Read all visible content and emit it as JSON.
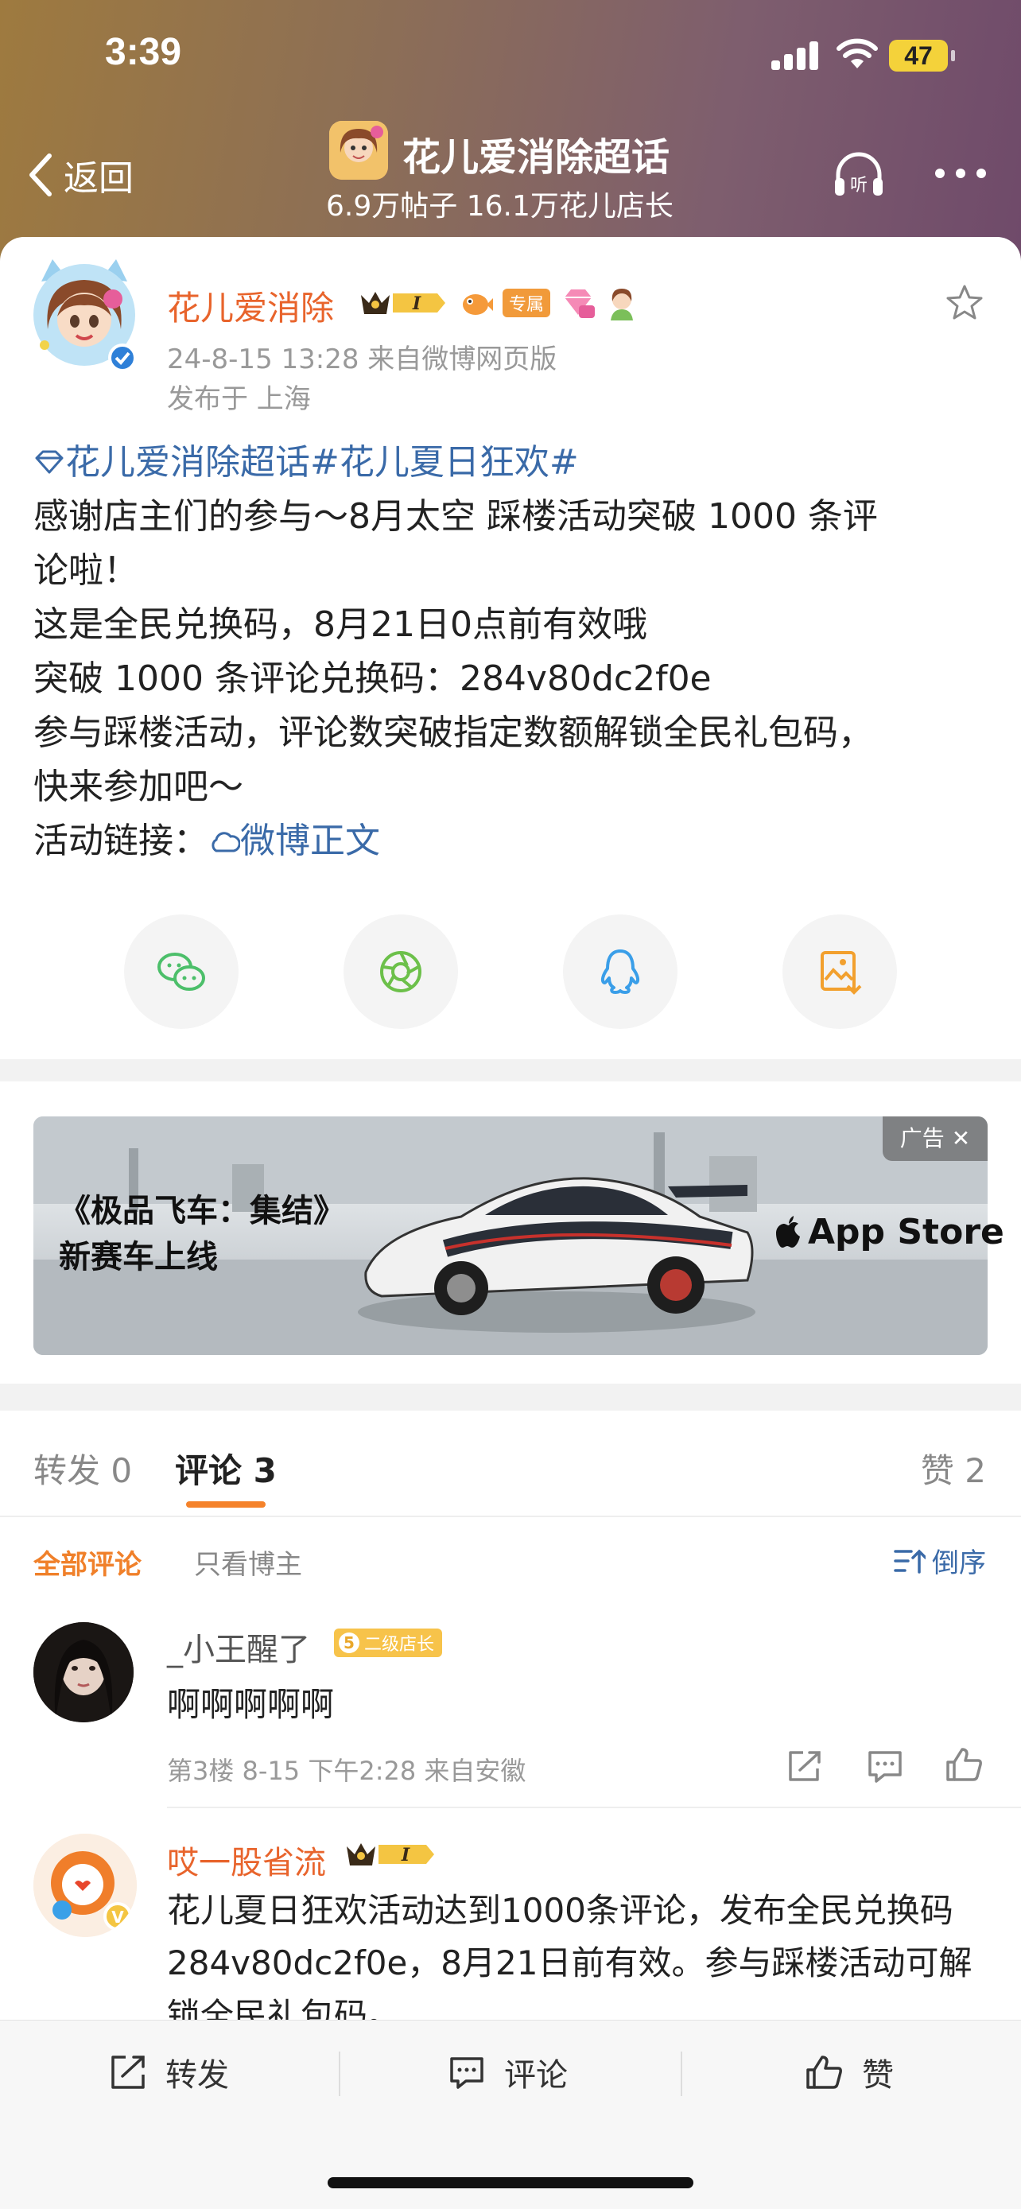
{
  "status": {
    "time": "3:39",
    "battery": "47"
  },
  "nav": {
    "back_label": "返回",
    "title": "花儿爱消除超话",
    "subtitle": "6.9万帖子 16.1万花儿店长"
  },
  "post": {
    "author": "花儿爱消除",
    "badge_zs": "专属",
    "meta_time_source": "24-8-15 13:28  来自微博网页版",
    "meta_location": "发布于 上海",
    "topic_prefix": "花儿爱消除超话#花儿夏日狂欢#",
    "lines": [
      "感谢店主们的参与～8月太空 踩楼活动突破 1000 条评",
      "论啦！",
      "这是全民兑换码，8月21日0点前有效哦",
      "突破 1000 条评论兑换码：284v80dc2f0e",
      "参与踩楼活动，评论数突破指定数额解锁全民礼包码，",
      "快来参加吧～"
    ],
    "link_label": "活动链接：",
    "link_text": "微博正文"
  },
  "ad": {
    "line1": "《极品飞车：集结》",
    "line2": "新赛车上线",
    "store": "App Store",
    "tag": "广告"
  },
  "tabs": {
    "repost": "转发 0",
    "comment": "评论 3",
    "like": "赞 2"
  },
  "filters": {
    "all": "全部评论",
    "author_only": "只看博主",
    "sort": "倒序"
  },
  "comments": [
    {
      "name": "_小王醒了",
      "badge_level": "5",
      "badge_text": "二级店长",
      "text": "啊啊啊啊啊",
      "meta": "第3楼 8-15 下午2:28  来自安徽"
    },
    {
      "name": "哎一股省流",
      "text": "花儿夏日狂欢活动达到1000条评论，发布全民兑换码284v80dc2f0e，8月21日前有效。参与踩楼活动可解锁全民礼包码。"
    }
  ],
  "toolbar": {
    "repost": "转发",
    "comment": "评论",
    "like": "赞"
  },
  "colors": {
    "accent_orange": "#f0802a",
    "link_blue": "#3a6aa8",
    "author_orange": "#e8642c"
  }
}
